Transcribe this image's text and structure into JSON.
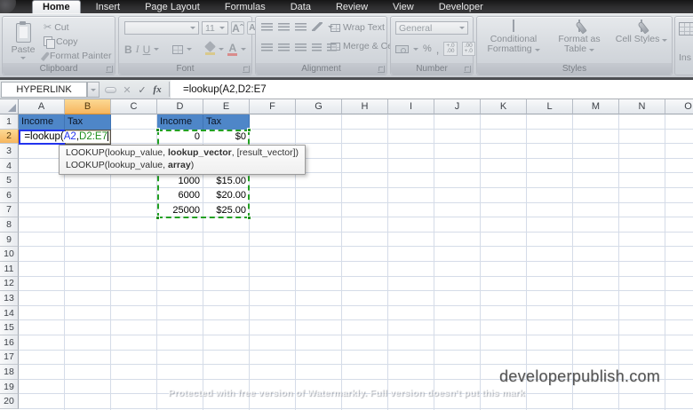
{
  "ribbon": {
    "tabs": [
      {
        "label": "Home",
        "active": true
      },
      {
        "label": "Insert",
        "active": false
      },
      {
        "label": "Page Layout",
        "active": false
      },
      {
        "label": "Formulas",
        "active": false
      },
      {
        "label": "Data",
        "active": false
      },
      {
        "label": "Review",
        "active": false
      },
      {
        "label": "View",
        "active": false
      },
      {
        "label": "Developer",
        "active": false
      }
    ],
    "clipboard": {
      "label": "Clipboard",
      "paste": "Paste",
      "items": [
        "Cut",
        "Copy",
        "Format Painter"
      ]
    },
    "font": {
      "label": "Font",
      "size": "11",
      "bold": "B",
      "italic": "I",
      "underline": "U",
      "grow": "A",
      "shrink": "A"
    },
    "alignment": {
      "label": "Alignment",
      "wrap_text": "Wrap Text",
      "merge_center": "Merge & Center"
    },
    "number": {
      "label": "Number",
      "format": "General",
      "percent": "%",
      "comma": ",",
      "inc_decimal_top": "+.0",
      "inc_decimal_bottom": ".00",
      "dec_decimal_top": ".00",
      "dec_decimal_bottom": "+.0"
    },
    "styles": {
      "label": "Styles",
      "conditional_formatting": "Conditional Formatting",
      "format_as_table": "Format as Table",
      "cell_styles": "Cell Styles"
    },
    "cells": {
      "partial_label": "Ins"
    }
  },
  "formula_bar": {
    "name_box": "HYPERLINK",
    "formula": "=lookup(A2,D2:E7"
  },
  "grid": {
    "columns": [
      "A",
      "B",
      "C",
      "D",
      "E",
      "F",
      "G",
      "H",
      "I",
      "J",
      "K",
      "L",
      "M",
      "N",
      "O"
    ],
    "visible_rows": 20,
    "active_column": "B",
    "active_row": 2,
    "cells": [
      {
        "col": "A",
        "row": 1,
        "text": "Income",
        "kind": "header"
      },
      {
        "col": "B",
        "row": 1,
        "text": "Tax",
        "kind": "header"
      },
      {
        "col": "D",
        "row": 1,
        "text": "Income",
        "kind": "header"
      },
      {
        "col": "E",
        "row": 1,
        "text": "Tax",
        "kind": "header"
      },
      {
        "col": "D",
        "row": 2,
        "text": "0",
        "kind": "number"
      },
      {
        "col": "E",
        "row": 2,
        "text": "$0",
        "kind": "number"
      },
      {
        "col": "D",
        "row": 5,
        "text": "1000",
        "kind": "number"
      },
      {
        "col": "E",
        "row": 5,
        "text": "$15.00",
        "kind": "number"
      },
      {
        "col": "D",
        "row": 6,
        "text": "6000",
        "kind": "number"
      },
      {
        "col": "E",
        "row": 6,
        "text": "$20.00",
        "kind": "number"
      },
      {
        "col": "D",
        "row": 7,
        "text": "25000",
        "kind": "number"
      },
      {
        "col": "E",
        "row": 7,
        "text": "$25.00",
        "kind": "number"
      }
    ],
    "formula_parts": [
      {
        "text": "=lookup(",
        "color": "#000000"
      },
      {
        "text": "A2",
        "color": "#2233ee"
      },
      {
        "text": ",",
        "color": "#000000"
      },
      {
        "text": "D2:E7",
        "color": "#1e8e1e"
      }
    ],
    "reference_range": "D2:E7",
    "reference_cell": "A2"
  },
  "tooltip": {
    "line1": [
      {
        "text": "LOOKUP(lookup_value, ",
        "bold": false
      },
      {
        "text": "lookup_vector",
        "bold": true
      },
      {
        "text": ", [result_vector])",
        "bold": false
      }
    ],
    "line2": [
      {
        "text": "LOOKUP(lookup_value, ",
        "bold": false
      },
      {
        "text": "array",
        "bold": true
      },
      {
        "text": ")",
        "bold": false
      }
    ]
  },
  "watermarks": {
    "site": "developerpublish.com",
    "notice": "Protected with free version of Watermarkly. Full version doesn't put this mark"
  },
  "colors": {
    "header_fill": "#4e86c8",
    "active_header": "#f6b55e",
    "reference_blue": "#2233ee",
    "reference_green": "#1e8e1e",
    "gridline": "#d5dce8"
  }
}
